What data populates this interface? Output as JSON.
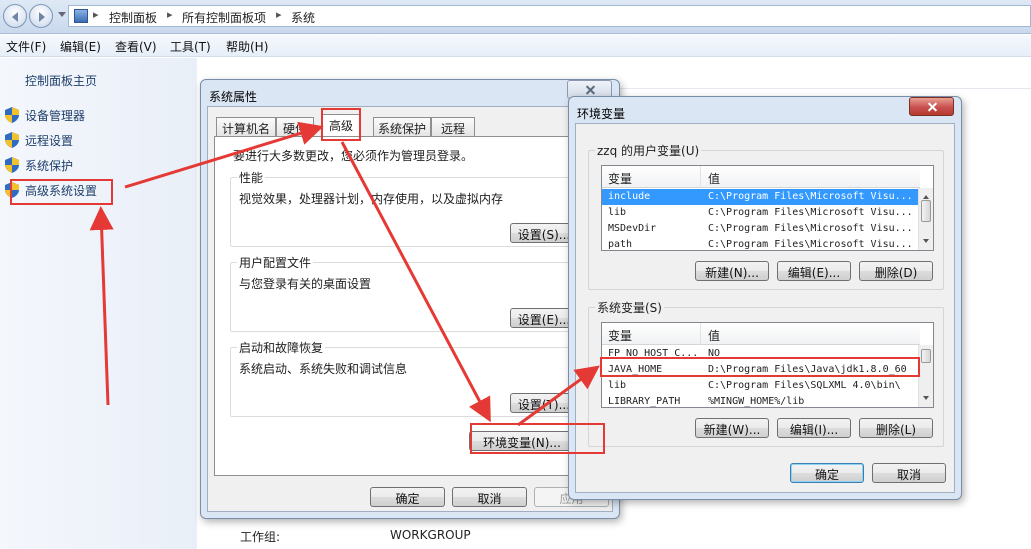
{
  "address": {
    "crumbs": [
      "控制面板",
      "所有控制面板项",
      "系统"
    ]
  },
  "menu": [
    "文件(F)",
    "编辑(E)",
    "查看(V)",
    "工具(T)",
    "帮助(H)"
  ],
  "left_panel": {
    "home": "控制面板主页",
    "items": [
      "设备管理器",
      "远程设置",
      "系统保护",
      "高级系统设置"
    ]
  },
  "background": {
    "workgroup_label": "工作组:",
    "workgroup_value": "WORKGROUP"
  },
  "sys_props": {
    "title": "系统属性",
    "tabs": [
      "计算机名",
      "硬件",
      "高级",
      "系统保护",
      "远程"
    ],
    "admin_note": "要进行大多数更改，您必须作为管理员登录。",
    "groups": [
      {
        "title": "性能",
        "desc": "视觉效果，处理器计划，内存使用，以及虚拟内存",
        "button": "设置(S)..."
      },
      {
        "title": "用户配置文件",
        "desc": "与您登录有关的桌面设置",
        "button": "设置(E)..."
      },
      {
        "title": "启动和故障恢复",
        "desc": "系统启动、系统失败和调试信息",
        "button": "设置(T)..."
      }
    ],
    "env_button": "环境变量(N)...",
    "ok": "确定",
    "cancel": "取消",
    "apply": "应用"
  },
  "env_vars": {
    "title": "环境变量",
    "user_section": "zzq 的用户变量(U)",
    "sys_section": "系统变量(S)",
    "col_var": "变量",
    "col_val": "值",
    "user_rows": [
      {
        "name": "include",
        "value": "C:\\Program Files\\Microsoft Visu..."
      },
      {
        "name": "lib",
        "value": "C:\\Program Files\\Microsoft Visu..."
      },
      {
        "name": "MSDevDir",
        "value": "C:\\Program Files\\Microsoft Visu..."
      },
      {
        "name": "path",
        "value": "C:\\Program Files\\Microsoft Visu..."
      }
    ],
    "sys_rows": [
      {
        "name": "FP_NO_HOST_C...",
        "value": "NO"
      },
      {
        "name": "JAVA_HOME",
        "value": "D:\\Program Files\\Java\\jdk1.8.0_60"
      },
      {
        "name": "lib",
        "value": "C:\\Program Files\\SQLXML 4.0\\bin\\"
      },
      {
        "name": "LIBRARY_PATH",
        "value": "%MINGW_HOME%/lib"
      }
    ],
    "user_buttons": [
      "新建(N)...",
      "编辑(E)...",
      "删除(D)"
    ],
    "sys_buttons": [
      "新建(W)...",
      "编辑(I)...",
      "删除(L)"
    ],
    "ok": "确定",
    "cancel": "取消"
  },
  "colors": {
    "annotation": "#e53935",
    "selection": "#3399ff"
  }
}
